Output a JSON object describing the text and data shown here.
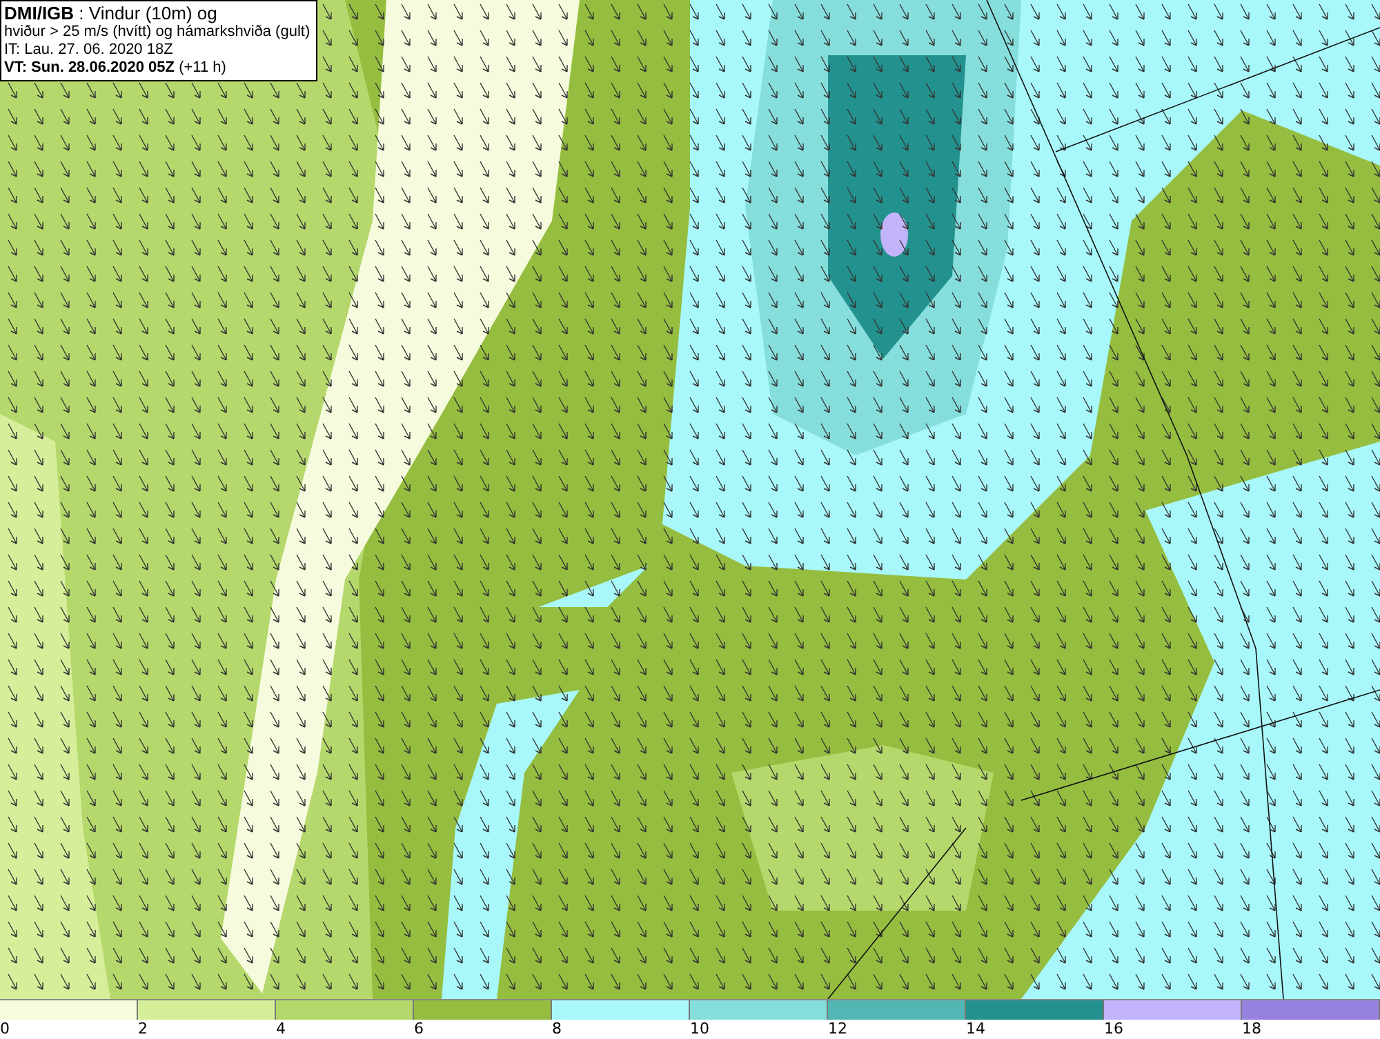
{
  "info_box": {
    "lines": [
      "**DMI/IGB** : Vindur (10m) og",
      "hviður > 25 m/s (hvítt) og hámarkshviða (gult)",
      "IT: Lau. 27. 06. 2020 18Z",
      "**VT: Sun. 28.06.2020 05Z** (+11 h)"
    ]
  },
  "legend": {
    "bins": [
      {
        "color": "#f5fbdc"
      },
      {
        "color": "#d6ee9a"
      },
      {
        "color": "#b5d86c"
      },
      {
        "color": "#95bd3f"
      },
      {
        "color": "#a8f8fb"
      },
      {
        "color": "#86dedc"
      },
      {
        "color": "#52b6b4"
      },
      {
        "color": "#23928e"
      },
      {
        "color": "#c3b3fb"
      },
      {
        "color": "#9682de"
      }
    ],
    "ticks": [
      "0",
      "2",
      "4",
      "6",
      "8",
      "10",
      "12",
      "14",
      "16",
      "18"
    ]
  }
}
